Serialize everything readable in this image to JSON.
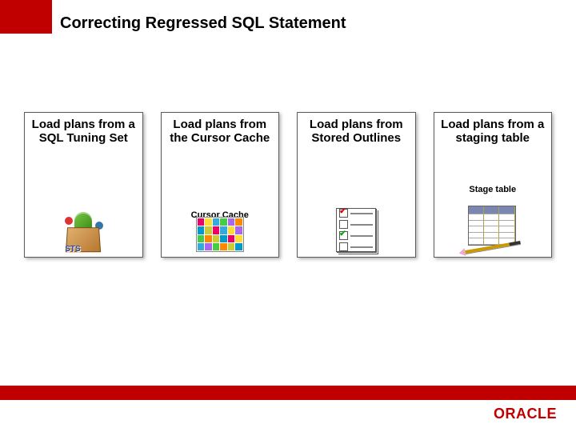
{
  "title": "Correcting Regressed SQL Statement",
  "cards": [
    {
      "heading": "Load plans from a SQL Tuning Set",
      "caption": "",
      "icon": "sts-box-icon",
      "badge": "STS"
    },
    {
      "heading": "Load plans from the Cursor Cache",
      "caption": "Cursor Cache",
      "icon": "color-grid-icon",
      "badge": ""
    },
    {
      "heading": "Load plans from Stored Outlines",
      "caption": "",
      "icon": "checklist-icon",
      "badge": ""
    },
    {
      "heading": "Load plans from a staging table",
      "caption": "Stage table",
      "icon": "table-pencil-icon",
      "badge": ""
    }
  ],
  "footer_logo": "ORACLE"
}
